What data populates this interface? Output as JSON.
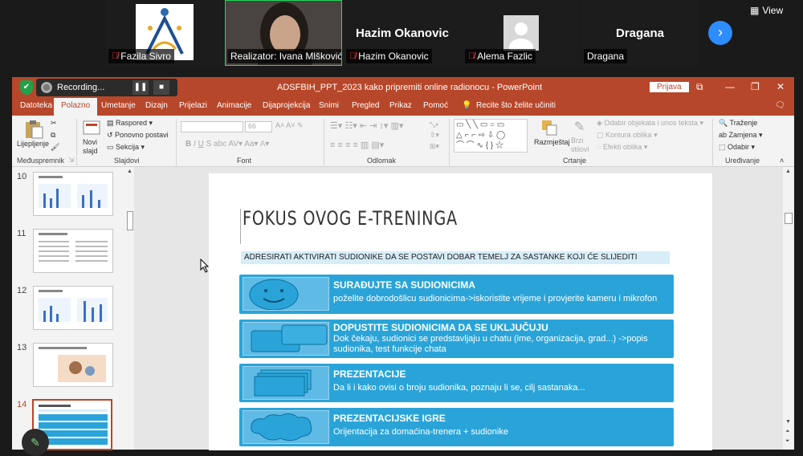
{
  "zoom": {
    "participants": [
      {
        "name": "Fazila Sivro",
        "muted": true,
        "type": "logo"
      },
      {
        "name": "Realizator: Ivana Mlšković",
        "muted": false,
        "type": "video",
        "active": true
      },
      {
        "name": "Hazim Okanovic",
        "big_name": "Hazim Okanovic",
        "muted": true,
        "type": "name"
      },
      {
        "name": "Alema Fazlic",
        "muted": true,
        "type": "avatar"
      },
      {
        "name": "Dragana",
        "big_name": "Dragana",
        "muted": false,
        "type": "name"
      }
    ],
    "view_label": "View",
    "recording_label": "Recording..."
  },
  "ppt": {
    "doc_title": "ADSFBIH_PPT_2023 kako pripremiti online radionocu  -  PowerPoint",
    "signin": "Prijava",
    "tabs": [
      "Datoteka",
      "Polazno",
      "Umetanje",
      "Dizajn",
      "Prijelazi",
      "Animacije",
      "Dijaprojekcija",
      "Snimi",
      "Pregled",
      "Prikaz",
      "Pomoć",
      "Recite što želite učiniti"
    ],
    "ribbon": {
      "paste": "Lijepljenje",
      "clipboard": "Međuspremnik",
      "new_slide": "Novi slajd",
      "layout": "Raspored",
      "reset": "Ponovno postavi",
      "section": "Sekcija",
      "slides": "Slajdovi",
      "font_size": "66",
      "font": "Font",
      "paragraph": "Odlomak",
      "arrange": "Razmještaj",
      "quick_styles": "Brzi stilovi",
      "shape_fill": "Odabir objekata i unos teksta",
      "shape_outline": "Kontura oblika",
      "shape_effects": "Efekti oblika",
      "drawing": "Crtanje",
      "find": "Traženje",
      "replace": "Zamjena",
      "select": "Odabir",
      "editing": "Uređivanje"
    },
    "thumbnails": [
      {
        "num": "10",
        "title": "USLUGE ZNANJA NA IZMJEŠTANOM RADU"
      },
      {
        "num": "11",
        "title": "KLJUČNI KORACI OPLANIRANJA"
      },
      {
        "num": "12",
        "title": "USLUGE ZNANJA NA IZMJEŠTANOM RADU"
      },
      {
        "num": "13",
        "title": "FOKUS E-TRENINGA: ANGAŽIRAJTE SUDIONIKE"
      },
      {
        "num": "14",
        "title": "FOKUS OVOG E-TRENINGA"
      }
    ],
    "slide": {
      "title": "FOKUS OVOG E-TRENINGA",
      "subtitle": "ADRESIRATI AKTIVIRATI SUDIONIKE DA SE POSTAVI DOBAR TEMELJ ZA SASTANKE KOJI ĆE SLIJEDITI",
      "cards": [
        {
          "title": "SURAĐUJTE SA SUDIONICIMA",
          "body": "poželite dobrodošlicu sudionicima->iskoristite vrijeme i provjerite kameru i mikrofon"
        },
        {
          "title": "DOPUSTITE SUDIONICIMA DA SE UKLJUČUJU",
          "body": "Dok čekaju, sudionici se predstavljaju u chatu (ime, organizacija, grad...) ->popis",
          "body2": "sudionika, test funkcije chata"
        },
        {
          "title": "PREZENTACIJE",
          "body": " Da li i kako ovisi o broju sudionika, poznaju li se, cilj sastanaka..."
        },
        {
          "title": "PREZENTACIJSKE IGRE",
          "body": "Orijentacija za domaćina-trenera + sudionike"
        }
      ]
    }
  }
}
